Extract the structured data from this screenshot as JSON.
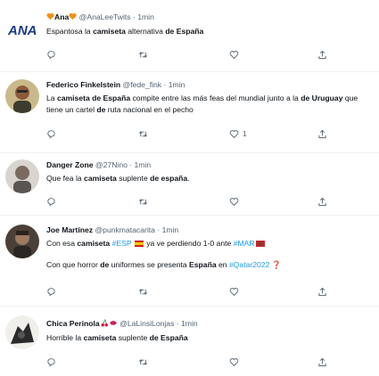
{
  "tweets": [
    {
      "name": "Ana",
      "handle": "@AnaLeeTwits",
      "time": "1min",
      "avatar_icon": "ana-logo",
      "text": [
        "Espantosa la ",
        "camiseta",
        " alternativa ",
        "de España"
      ],
      "likes": ""
    },
    {
      "name": "Federico Finkelstein",
      "handle": "@fede_fink",
      "time": "1min",
      "avatar_icon": "person-photo",
      "text": [
        "La ",
        "camiseta de España",
        " compite entre las más feas del mundial junto a la ",
        "de Uruguay",
        " que tiene un cartel ",
        "de",
        " ruta nacional en el pecho"
      ],
      "likes": "1"
    },
    {
      "name": "Danger Zone",
      "handle": "@27Nino",
      "time": "1min",
      "avatar_icon": "person-photo",
      "text": [
        "Que fea la ",
        "camiseta",
        " suplente ",
        "de españa",
        "."
      ],
      "likes": ""
    },
    {
      "name": "Joe Martínez",
      "handle": "@punkmatacarita",
      "time": "1min",
      "avatar_icon": "person-photo",
      "text": [
        "Con esa ",
        "camiseta",
        " ",
        "#ESP",
        " ya ve perdiendo 1-0 ante ",
        "#MAR"
      ],
      "text2": [
        "Con que horror ",
        "de",
        " uniformes se presenta ",
        "España",
        " en ",
        "#Qatar2022",
        " ❓"
      ],
      "likes": ""
    },
    {
      "name": "Chica Perinola",
      "handle": "@LaLinsiLonjas",
      "time": "1min",
      "avatar_icon": "person-photo",
      "text": [
        "Horrible la ",
        "camiseta",
        " suplente ",
        "de España"
      ],
      "likes": ""
    }
  ],
  "colors": {
    "accent": "#1d9bf0",
    "muted": "#536471",
    "divider": "#eff3f4"
  }
}
